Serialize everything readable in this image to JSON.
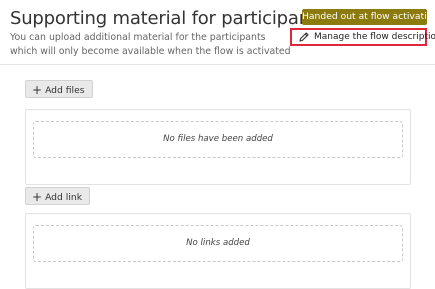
{
  "header": {
    "title": "Supporting material for participants",
    "subtitle": "You can upload additional material for the participants which will only become available when the flow is activated",
    "status_badge": "Handed out at flow activation",
    "manage_label": "Manage the flow description",
    "manage_icon": "pencil-icon",
    "highlight_color": "#e0263b",
    "badge_color": "#8b7a0d"
  },
  "files": {
    "add_label": "Add files",
    "add_icon": "plus-icon",
    "empty_text": "No files have been added"
  },
  "links": {
    "add_label": "Add link",
    "add_icon": "plus-icon",
    "empty_text": "No links added"
  }
}
